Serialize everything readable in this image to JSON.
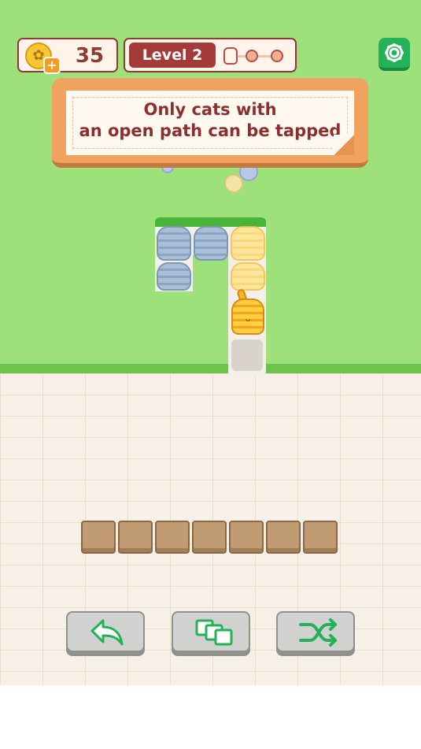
{
  "hud": {
    "coins": "35",
    "level_label": "Level 2",
    "level_progress_filled": 0,
    "level_progress_total": 2
  },
  "tutorial": {
    "line1": "Only cats with",
    "line2": "an open path can be tapped"
  },
  "board": {
    "cats": [
      {
        "color": "blue",
        "state": "blocked"
      },
      {
        "color": "blue",
        "state": "blocked"
      },
      {
        "color": "blue",
        "state": "blocked"
      },
      {
        "color": "yellow",
        "state": "blocked"
      },
      {
        "color": "yellow",
        "state": "blocked"
      },
      {
        "color": "orange",
        "state": "tappable"
      }
    ]
  },
  "collection_tray": {
    "slots_total": 7,
    "slots_filled": 0
  },
  "toolbar": {
    "buttons": [
      {
        "name": "undo",
        "icon": "undo-arrow-icon"
      },
      {
        "name": "group",
        "icon": "stack-icon"
      },
      {
        "name": "shuffle",
        "icon": "shuffle-icon"
      }
    ]
  },
  "colors": {
    "grass": "#9ee07a",
    "floor": "#f6f0e6",
    "accent_green": "#23b258",
    "panel_red": "#a33b3a",
    "banner_orange": "#f0a35e"
  }
}
